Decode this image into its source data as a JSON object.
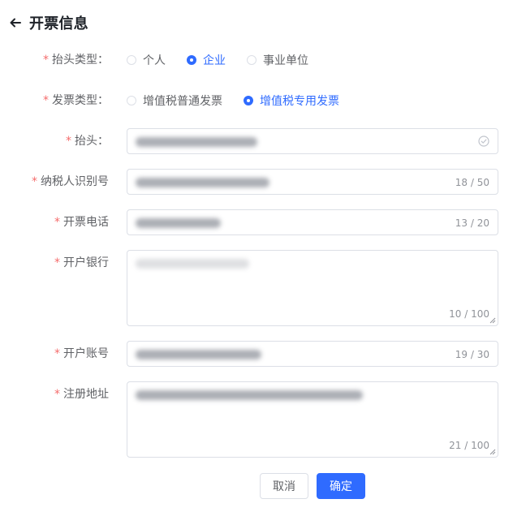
{
  "header": {
    "title": "开票信息"
  },
  "form": {
    "title_type": {
      "label": "抬头类型：",
      "options": [
        {
          "label": "个人",
          "checked": false
        },
        {
          "label": "企业",
          "checked": true
        },
        {
          "label": "事业单位",
          "checked": false
        }
      ]
    },
    "invoice_type": {
      "label": "发票类型：",
      "options": [
        {
          "label": "增值税普通发票",
          "checked": false
        },
        {
          "label": "增值税专用发票",
          "checked": true
        }
      ]
    },
    "header_field": {
      "label": "抬头："
    },
    "tax_id": {
      "label": "纳税人识别号",
      "count": "18 / 50"
    },
    "phone": {
      "label": "开票电话",
      "count": "13 / 20"
    },
    "bank": {
      "label": "开户银行",
      "count": "10 / 100"
    },
    "account": {
      "label": "开户账号",
      "count": "19 / 30"
    },
    "address": {
      "label": "注册地址",
      "count": "21 / 100"
    }
  },
  "actions": {
    "cancel": "取消",
    "confirm": "确定"
  },
  "colors": {
    "primary": "#2f6bff",
    "required": "#f56c6c"
  }
}
